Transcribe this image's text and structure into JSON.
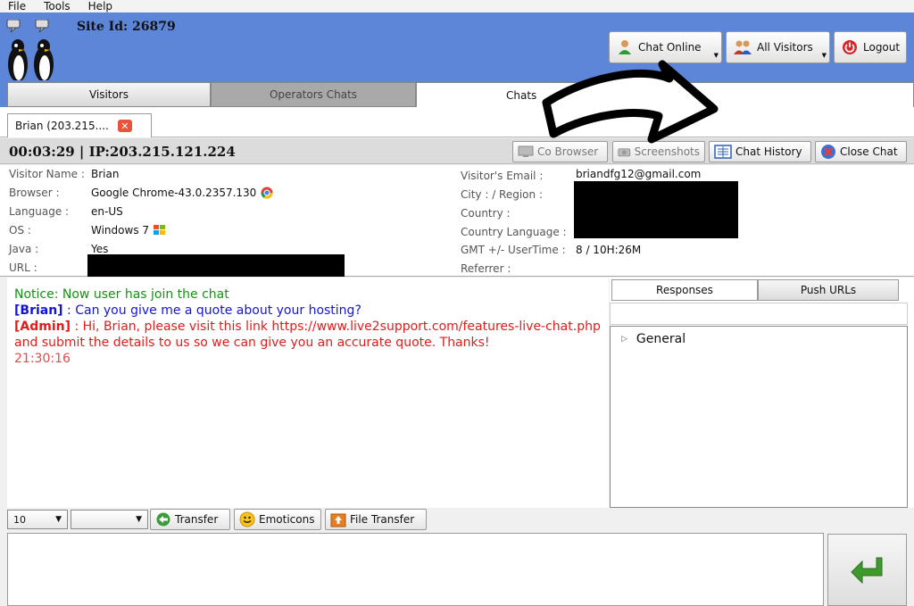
{
  "menu": {
    "file": "File",
    "tools": "Tools",
    "help": "Help"
  },
  "header": {
    "site_id": "Site Id: 26879",
    "chat_online": "Chat Online",
    "all_visitors": "All Visitors",
    "logout": "Logout"
  },
  "main_tabs": {
    "visitors": "Visitors",
    "operators_chats": "Operators Chats",
    "chats": "Chats"
  },
  "chat_tab": {
    "label": "Brian (203.215...."
  },
  "infobar": {
    "timer_ip": "00:03:29  |  IP:203.215.121.224",
    "co_browser": "Co Browser",
    "screenshots": "Screenshots",
    "chat_history": "Chat History",
    "close_chat": "Close Chat"
  },
  "visitor": {
    "name_label": "Visitor Name :",
    "name": "Brian",
    "browser_label": "Browser :",
    "browser": "Google Chrome-43.0.2357.130",
    "language_label": "Language :",
    "language": "en-US",
    "os_label": "OS :",
    "os": "Windows 7",
    "java_label": "Java :",
    "java": "Yes",
    "url_label": "URL :",
    "email_label": "Visitor's Email :",
    "email": "briandfg12@gmail.com",
    "city_label": "City : / Region :",
    "country_label": "Country :",
    "country_language_label": "Country Language :",
    "gmt_label": "GMT +/- UserTime :",
    "gmt": "8 / 10H:26M",
    "referrer_label": "Referrer :"
  },
  "chat": {
    "notice": "Notice: Now user has join the chat",
    "brian_name": "[Brian]",
    "brian_msg": " : Can you give me a quote about your hosting?",
    "admin_name": "[Admin]",
    "admin_msg": " : Hi, Brian, please visit this link https://www.live2support.com/features-live-chat.php and submit the details to us so we can give you an accurate quote. Thanks!",
    "timestamp": "21:30:16"
  },
  "responses": {
    "tab_responses": "Responses",
    "tab_push": "Push URLs",
    "node_general": "General"
  },
  "bottom": {
    "font_size": "10",
    "font_face": "",
    "transfer": "Transfer",
    "emoticons": "Emoticons",
    "file_transfer": "File Transfer"
  },
  "colors": {
    "header_blue": "#5d86d9",
    "notice_green": "#169116",
    "visitor_blue": "#1414d8",
    "admin_red": "#e21b1b",
    "send_green": "#3f9a2c"
  }
}
